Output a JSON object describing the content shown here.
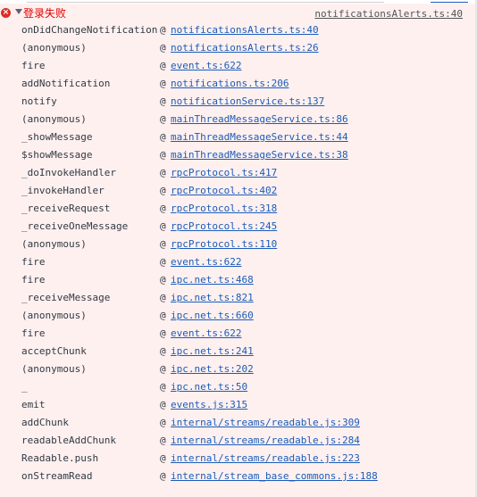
{
  "console": {
    "error_title": "登录失败",
    "source_link": "notificationsAlerts.ts:40",
    "at_symbol": "@",
    "icons": {
      "error": "error-circle-icon",
      "expand": "triangle-down-icon"
    },
    "colors": {
      "error_text": "#e00000",
      "error_icon": "#d93025",
      "row_background": "#fff0f0",
      "link": "#1a5db8",
      "text": "#303942"
    },
    "frames": [
      {
        "fn": "onDidChangeNotification",
        "loc": "notificationsAlerts.ts:40"
      },
      {
        "fn": "(anonymous)",
        "loc": "notificationsAlerts.ts:26"
      },
      {
        "fn": "fire",
        "loc": "event.ts:622"
      },
      {
        "fn": "addNotification",
        "loc": "notifications.ts:206"
      },
      {
        "fn": "notify",
        "loc": "notificationService.ts:137"
      },
      {
        "fn": "(anonymous)",
        "loc": "mainThreadMessageService.ts:86"
      },
      {
        "fn": "_showMessage",
        "loc": "mainThreadMessageService.ts:44"
      },
      {
        "fn": "$showMessage",
        "loc": "mainThreadMessageService.ts:38"
      },
      {
        "fn": "_doInvokeHandler",
        "loc": "rpcProtocol.ts:417"
      },
      {
        "fn": "_invokeHandler",
        "loc": "rpcProtocol.ts:402"
      },
      {
        "fn": "_receiveRequest",
        "loc": "rpcProtocol.ts:318"
      },
      {
        "fn": "_receiveOneMessage",
        "loc": "rpcProtocol.ts:245"
      },
      {
        "fn": "(anonymous)",
        "loc": "rpcProtocol.ts:110"
      },
      {
        "fn": "fire",
        "loc": "event.ts:622"
      },
      {
        "fn": "fire",
        "loc": "ipc.net.ts:468"
      },
      {
        "fn": "_receiveMessage",
        "loc": "ipc.net.ts:821"
      },
      {
        "fn": "(anonymous)",
        "loc": "ipc.net.ts:660"
      },
      {
        "fn": "fire",
        "loc": "event.ts:622"
      },
      {
        "fn": "acceptChunk",
        "loc": "ipc.net.ts:241"
      },
      {
        "fn": "(anonymous)",
        "loc": "ipc.net.ts:202"
      },
      {
        "fn": "_",
        "loc": "ipc.net.ts:50"
      },
      {
        "fn": "emit",
        "loc": "events.js:315"
      },
      {
        "fn": "addChunk",
        "loc": "internal/streams/readable.js:309"
      },
      {
        "fn": "readableAddChunk",
        "loc": "internal/streams/readable.js:284"
      },
      {
        "fn": "Readable.push",
        "loc": "internal/streams/readable.js:223"
      },
      {
        "fn": "onStreamRead",
        "loc": "internal/stream_base_commons.js:188"
      }
    ]
  }
}
